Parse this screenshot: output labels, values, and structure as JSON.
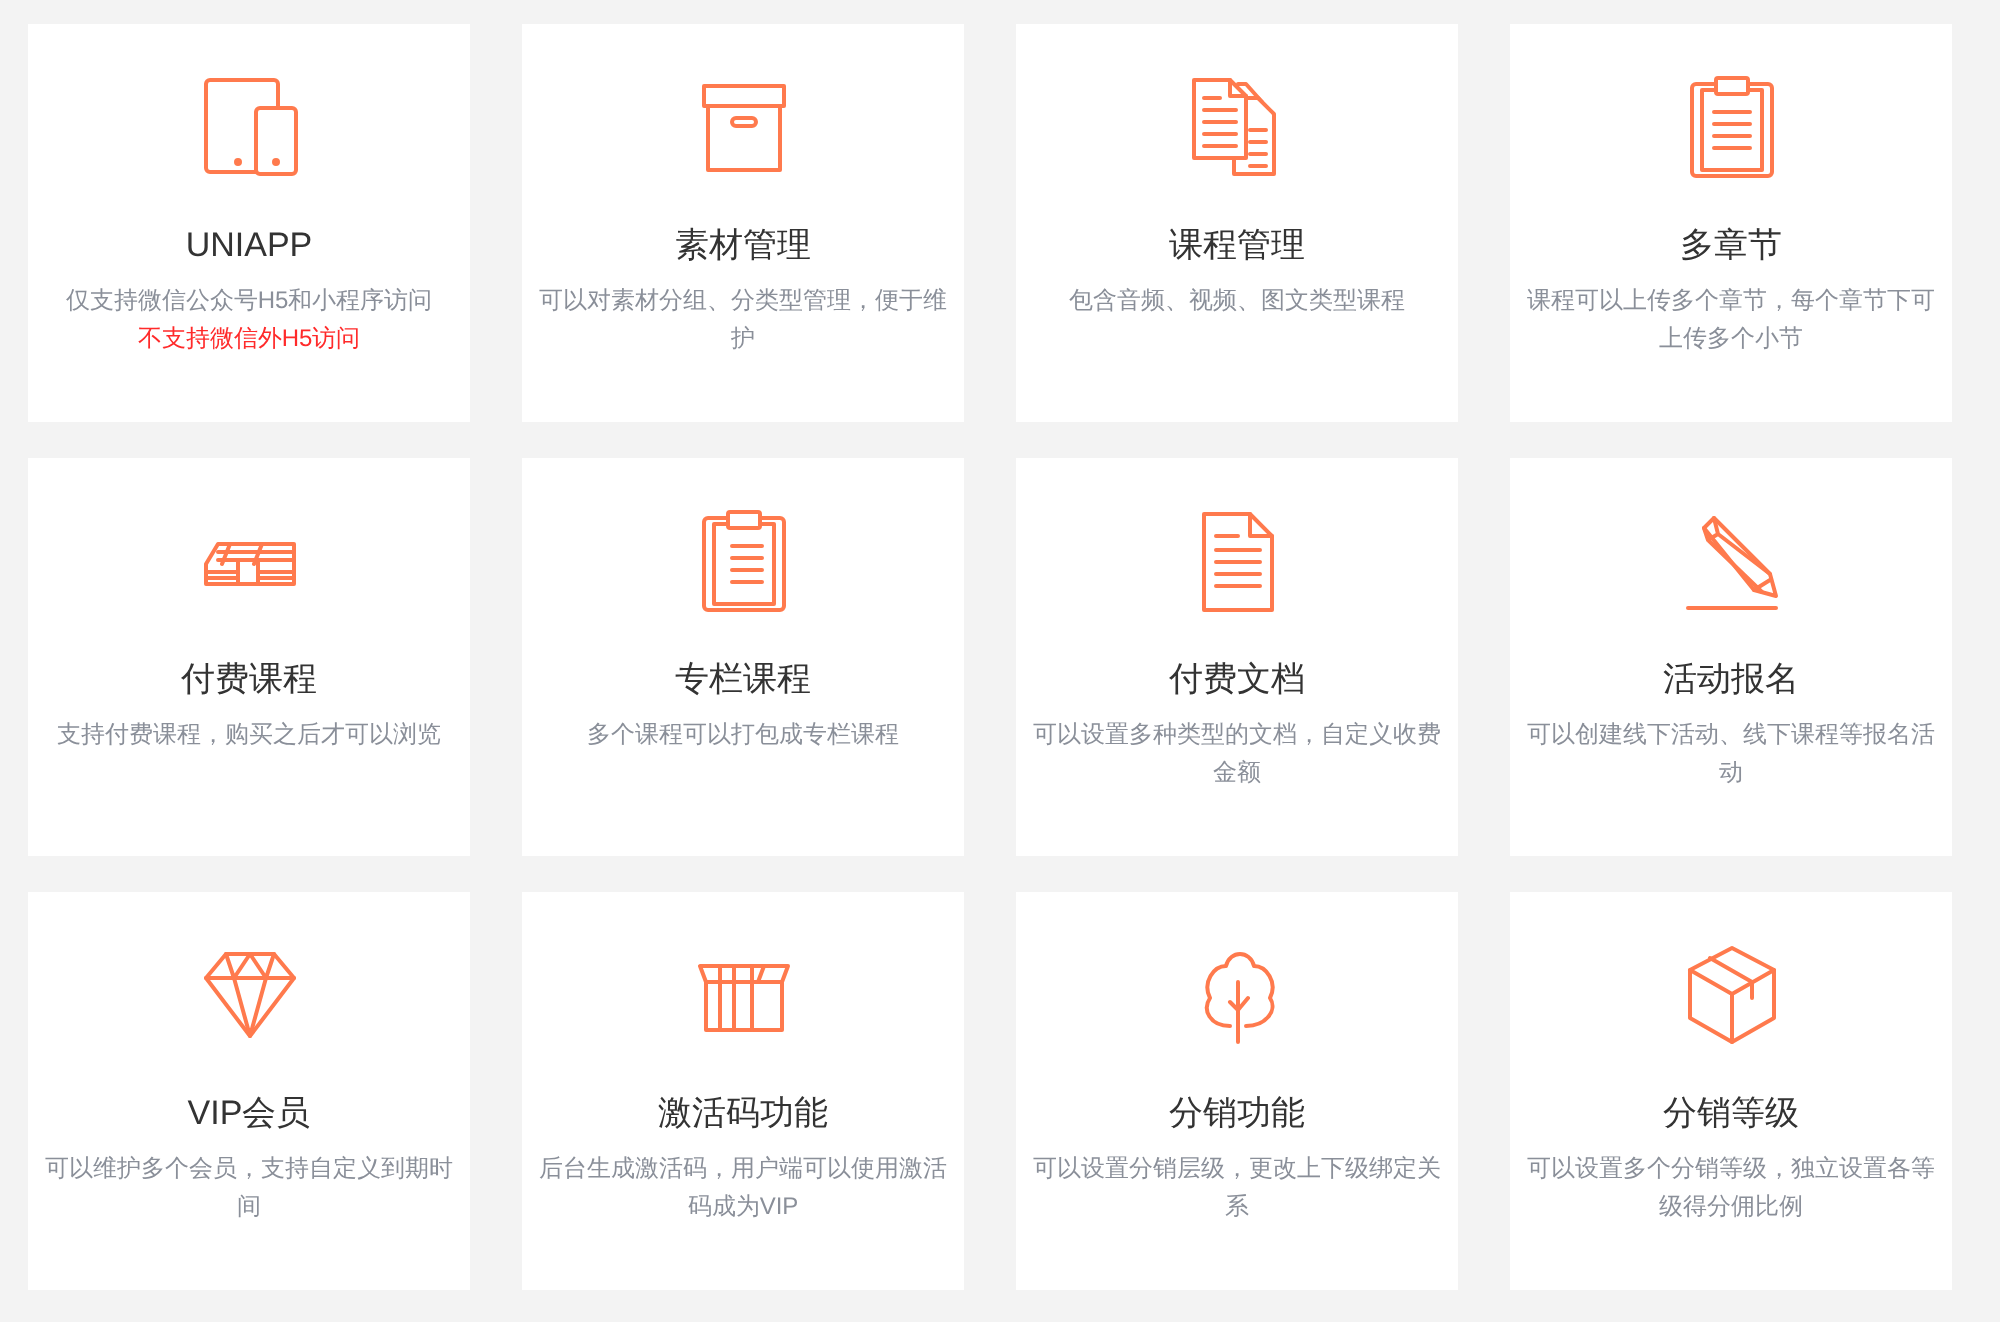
{
  "features": [
    {
      "title": "UNIAPP",
      "description": "仅支持微信公众号H5和小程序访问",
      "note": "不支持微信外H5访问"
    },
    {
      "title": "素材管理",
      "description": "可以对素材分组、分类型管理，便于维护"
    },
    {
      "title": "课程管理",
      "description": "包含音频、视频、图文类型课程"
    },
    {
      "title": "多章节",
      "description": "课程可以上传多个章节，每个章节下可上传多个小节"
    },
    {
      "title": "付费课程",
      "description": "支持付费课程，购买之后才可以浏览"
    },
    {
      "title": "专栏课程",
      "description": "多个课程可以打包成专栏课程"
    },
    {
      "title": "付费文档",
      "description": "可以设置多种类型的文档，自定义收费金额"
    },
    {
      "title": "活动报名",
      "description": "可以创建线下活动、线下课程等报名活动"
    },
    {
      "title": "VIP会员",
      "description": "可以维护多个会员，支持自定义到期时间"
    },
    {
      "title": "激活码功能",
      "description": "后台生成激活码，用户端可以使用激活码成为VIP"
    },
    {
      "title": "分销功能",
      "description": "可以设置分销层级，更改上下级绑定关系"
    },
    {
      "title": "分销等级",
      "description": "可以设置多个分销等级，独立设置各等级得分佣比例"
    }
  ]
}
